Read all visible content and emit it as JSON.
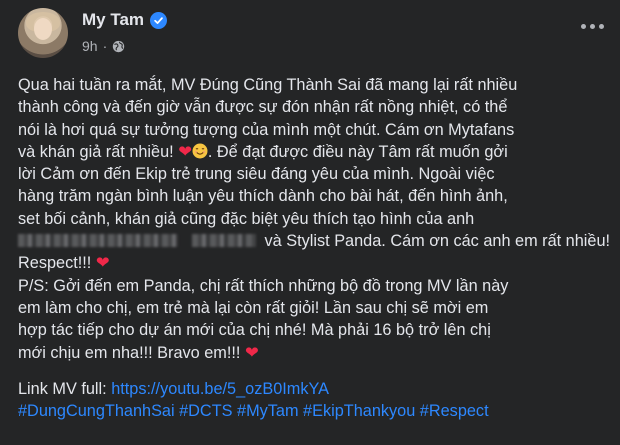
{
  "author": {
    "name": "My Tam",
    "time": "9h"
  },
  "colors": {
    "background": "#242526",
    "text": "#e4e6eb",
    "muted": "#b0b3b8",
    "link": "#2d88ff",
    "heart": "#f02849"
  },
  "icons": {
    "verified": "verified-check-icon",
    "audience": "globe-icon",
    "menu": "more-options-icon"
  },
  "post": {
    "l1": "Qua hai tuần ra mắt, MV Đúng Cũng Thành Sai đã mang lại rất nhiều",
    "l2": "thành công và đến giờ vẫn được sự đón nhận rất nồng nhiệt, có thể",
    "l3": "nói là hơi quá sự tưởng tượng của mình một chút. Cám ơn Mytafans",
    "l4a": "và khán giả rất nhiều!",
    "heart": "❤",
    "l4b": ". Để đạt được điều này Tâm rất muốn gởi",
    "l5": "lời Cảm ơn đến Ekip trẻ trung siêu đáng yêu của mình. Ngoài việc",
    "l6": "hàng trăm ngàn bình luận yêu thích dành cho bài hát, đến hình ảnh,",
    "l7": "set bối cảnh, khán giả cũng đặc biệt yêu thích tạo hình của anh",
    "l8": "và Stylist Panda. Cám ơn các anh em rất nhiều!",
    "l9": "Respect!!!",
    "l10": "P/S: Gởi đến em Panda, chị rất thích những bộ đồ trong MV lần này",
    "l11": "em làm cho chị, em trẻ mà lại còn rất giỏi! Lần sau chị sẽ mời em",
    "l12": "hợp tác tiếp cho dự án mới của chị nhé! Mà phải 16 bộ trở lên chị",
    "l13": "mới chịu em nha!!! Bravo em!!!",
    "link_label": "Link MV full: ",
    "link_url": "https://youtu.be/5_ozB0ImkYA",
    "hashtags": "#DungCungThanhSai #DCTS #MyTam #EkipThankyou #Respect"
  }
}
